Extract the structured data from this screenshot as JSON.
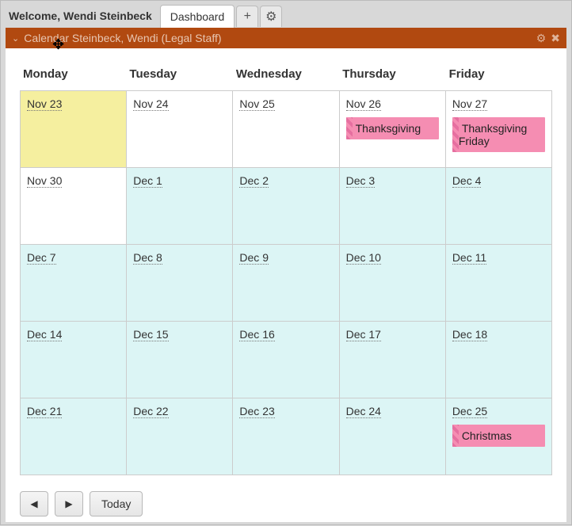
{
  "header": {
    "welcome": "Welcome, Wendi Steinbeck",
    "tabs": [
      {
        "label": "Dashboard"
      }
    ]
  },
  "panel": {
    "title": "Calendar Steinbeck, Wendi (Legal Staff)"
  },
  "calendar": {
    "day_headers": [
      "Monday",
      "Tuesday",
      "Wednesday",
      "Thursday",
      "Friday"
    ],
    "weeks": [
      [
        {
          "label": "Nov 23",
          "kind": "today",
          "events": []
        },
        {
          "label": "Nov 24",
          "kind": "out",
          "events": []
        },
        {
          "label": "Nov 25",
          "kind": "out",
          "events": []
        },
        {
          "label": "Nov 26",
          "kind": "out",
          "events": [
            "Thanksgiving"
          ]
        },
        {
          "label": "Nov 27",
          "kind": "out",
          "events": [
            "Thanksgiving Friday"
          ]
        }
      ],
      [
        {
          "label": "Nov 30",
          "kind": "out",
          "events": []
        },
        {
          "label": "Dec 1",
          "kind": "in",
          "events": []
        },
        {
          "label": "Dec 2",
          "kind": "in",
          "events": []
        },
        {
          "label": "Dec 3",
          "kind": "in",
          "events": []
        },
        {
          "label": "Dec 4",
          "kind": "in",
          "events": []
        }
      ],
      [
        {
          "label": "Dec 7",
          "kind": "in",
          "events": []
        },
        {
          "label": "Dec 8",
          "kind": "in",
          "events": []
        },
        {
          "label": "Dec 9",
          "kind": "in",
          "events": []
        },
        {
          "label": "Dec 10",
          "kind": "in",
          "events": []
        },
        {
          "label": "Dec 11",
          "kind": "in",
          "events": []
        }
      ],
      [
        {
          "label": "Dec 14",
          "kind": "in",
          "events": []
        },
        {
          "label": "Dec 15",
          "kind": "in",
          "events": []
        },
        {
          "label": "Dec 16",
          "kind": "in",
          "events": []
        },
        {
          "label": "Dec 17",
          "kind": "in",
          "events": []
        },
        {
          "label": "Dec 18",
          "kind": "in",
          "events": []
        }
      ],
      [
        {
          "label": "Dec 21",
          "kind": "in",
          "events": []
        },
        {
          "label": "Dec 22",
          "kind": "in",
          "events": []
        },
        {
          "label": "Dec 23",
          "kind": "in",
          "events": []
        },
        {
          "label": "Dec 24",
          "kind": "in",
          "events": []
        },
        {
          "label": "Dec 25",
          "kind": "in",
          "events": [
            "Christmas"
          ]
        }
      ]
    ]
  },
  "footer": {
    "prev": "◀",
    "next": "▶",
    "today": "Today"
  },
  "icons": {
    "plus": "+",
    "gear": "⚙",
    "close": "✖",
    "chevron_down": "⌄",
    "move": "✥"
  }
}
